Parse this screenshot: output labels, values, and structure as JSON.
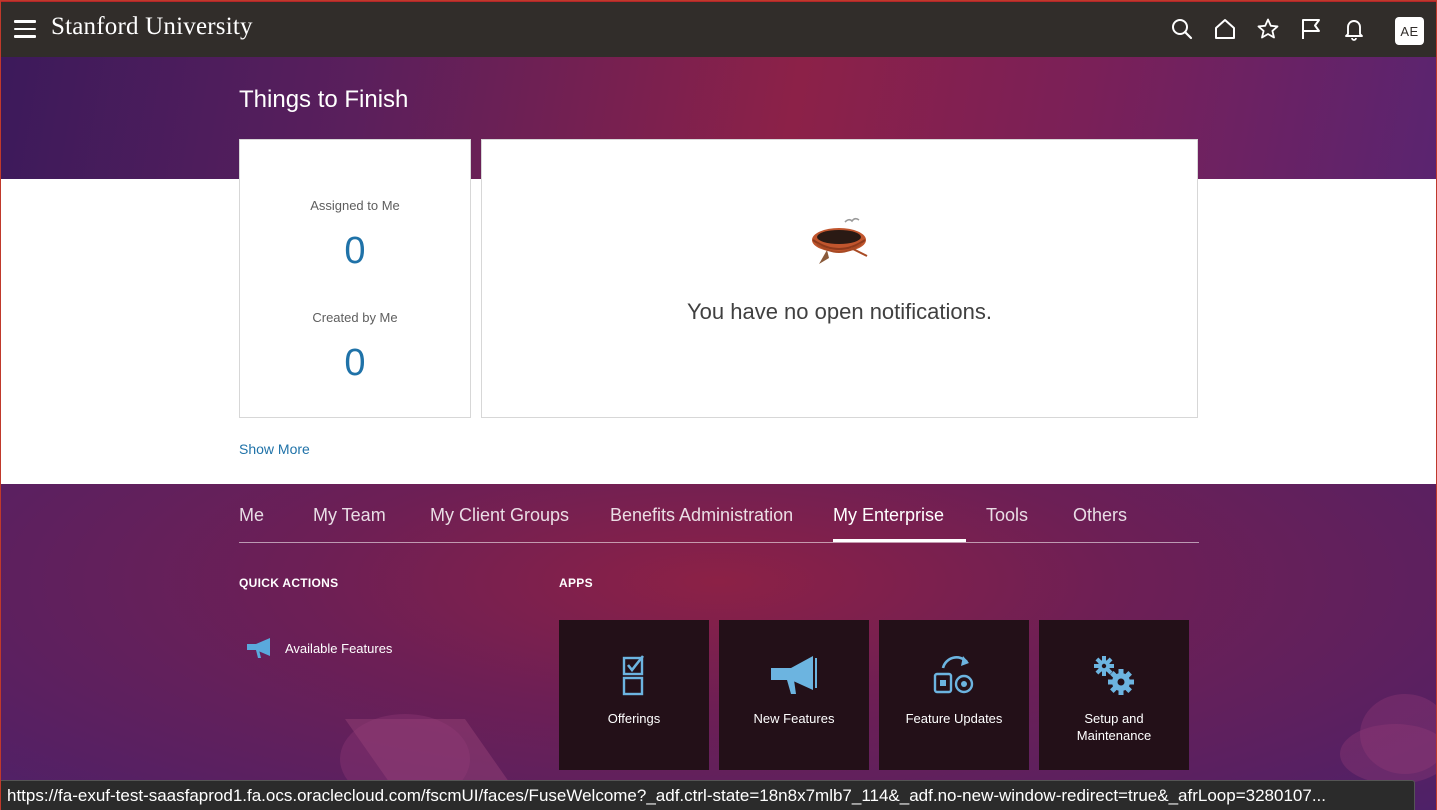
{
  "header": {
    "brand": "Stanford University",
    "avatar_initials": "AE",
    "icons": [
      "menu-icon",
      "search-icon",
      "home-icon",
      "star-icon",
      "flag-icon",
      "bell-icon"
    ]
  },
  "things_to_finish": {
    "title": "Things to Finish",
    "assigned_label": "Assigned to Me",
    "assigned_count": "0",
    "created_label": "Created by Me",
    "created_count": "0",
    "notifications_empty": "You have no open notifications.",
    "show_more": "Show More"
  },
  "tabs": [
    {
      "label": "Me",
      "active": false
    },
    {
      "label": "My Team",
      "active": false
    },
    {
      "label": "My Client Groups",
      "active": false
    },
    {
      "label": "Benefits Administration",
      "active": false
    },
    {
      "label": "My Enterprise",
      "active": true
    },
    {
      "label": "Tools",
      "active": false
    },
    {
      "label": "Others",
      "active": false
    }
  ],
  "quick_actions": {
    "heading": "QUICK ACTIONS",
    "items": [
      {
        "label": "Available Features",
        "icon": "megaphone-icon"
      }
    ]
  },
  "apps": {
    "heading": "APPS",
    "tiles": [
      {
        "label": "Offerings",
        "icon": "checklist-icon"
      },
      {
        "label": "New Features",
        "icon": "megaphone-icon"
      },
      {
        "label": "Feature Updates",
        "icon": "refresh-settings-icon"
      },
      {
        "label": "Setup and Maintenance",
        "icon": "gears-icon"
      }
    ]
  },
  "status_bar": {
    "url": "https://fa-exuf-test-saasfaprod1.fa.ocs.oraclecloud.com/fscmUI/faces/FuseWelcome?_adf.ctrl-state=18n8x7mlb7_114&_adf.no-new-window-redirect=true&_afrLoop=3280107..."
  },
  "colors": {
    "header_bg": "#312d2a",
    "accent_blue": "#1f72a8",
    "tile_bg": "#231018",
    "icon_blue": "#6cb4e0"
  }
}
